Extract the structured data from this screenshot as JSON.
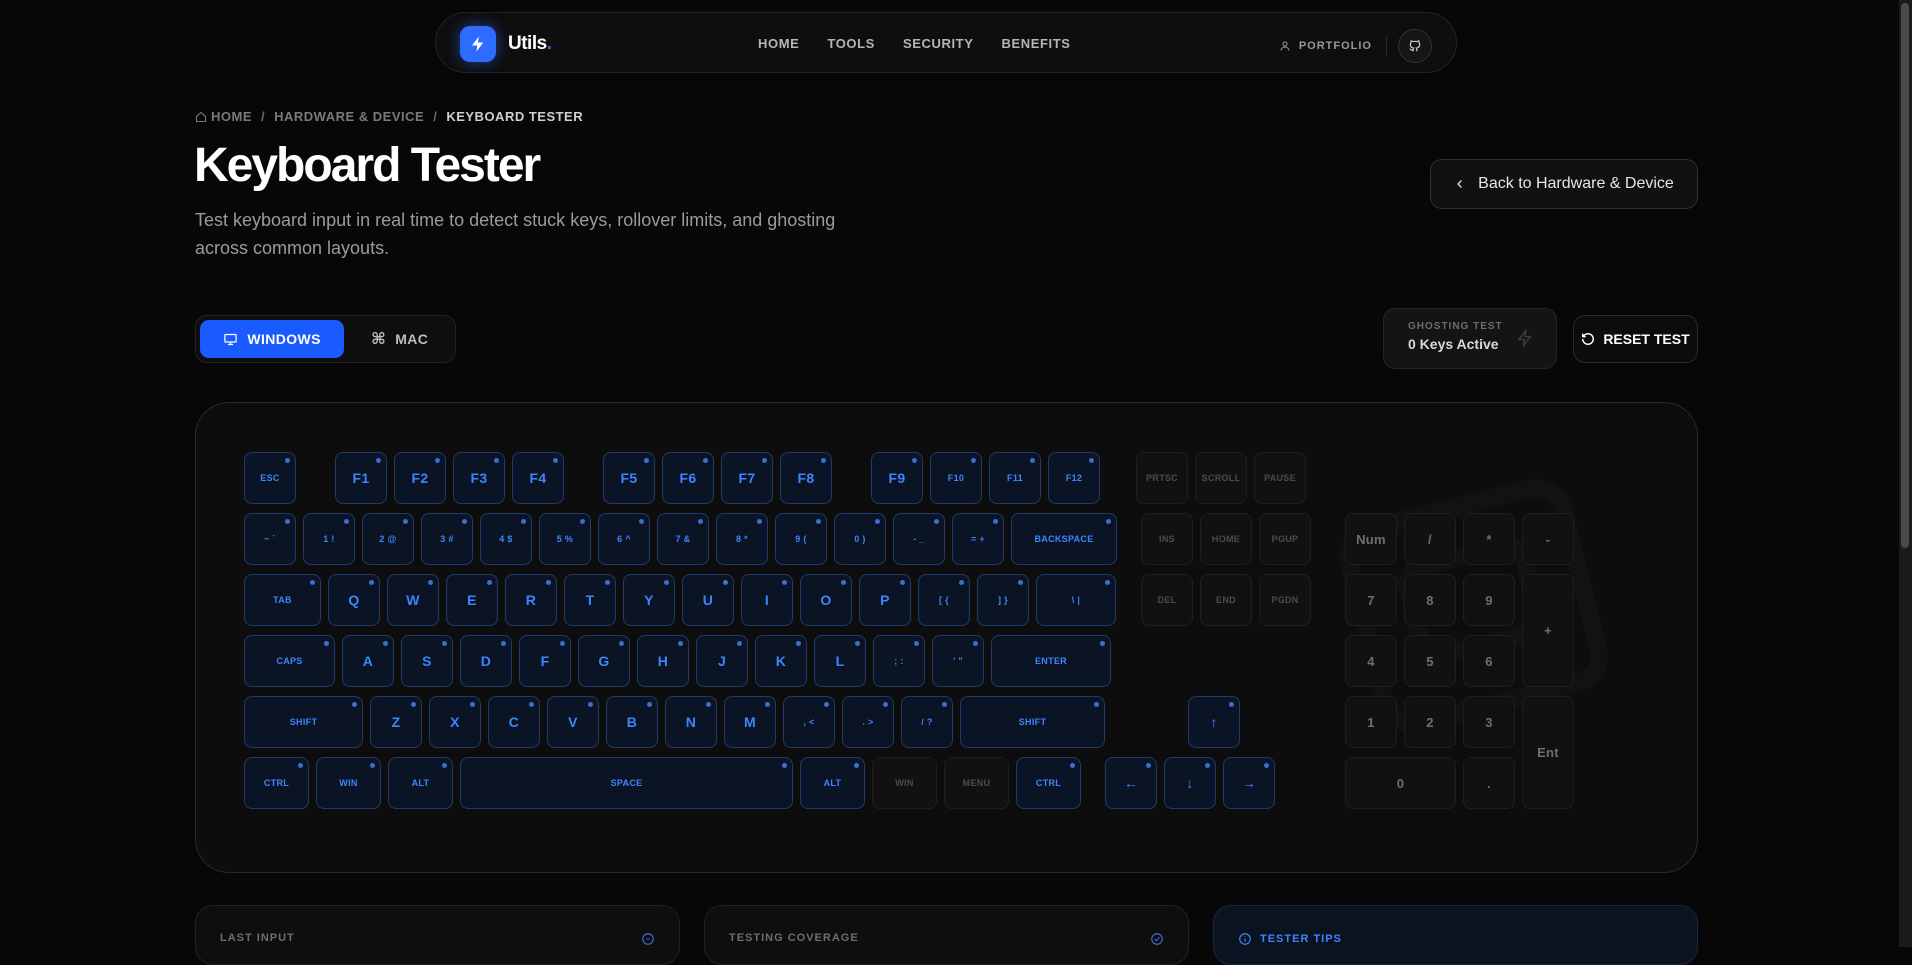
{
  "nav": {
    "logo": "Utils",
    "logo_dot": ".",
    "links": [
      "HOME",
      "TOOLS",
      "SECURITY",
      "BENEFITS"
    ],
    "portfolio": "PORTFOLIO"
  },
  "breadcrumb": {
    "home": "HOME",
    "category": "HARDWARE & DEVICE",
    "current": "KEYBOARD TESTER",
    "separator": "/"
  },
  "page": {
    "title": "Keyboard Tester",
    "description": "Test keyboard input in real time to detect stuck keys, rollover limits, and ghosting across common layouts.",
    "back_label": "Back to Hardware & Device"
  },
  "controls": {
    "os_windows": "WINDOWS",
    "os_mac": "MAC",
    "ghost_label": "GHOSTING TEST",
    "ghost_value": "0 Keys Active",
    "reset_label": "RESET TEST"
  },
  "keyboard": {
    "main_rows": [
      [
        {
          "l": "ESC",
          "w": 52,
          "sm": true
        },
        {
          "gap": 32
        },
        {
          "l": "F1",
          "w": 52,
          "big": true
        },
        {
          "l": "F2",
          "w": 52,
          "big": true
        },
        {
          "l": "F3",
          "w": 52,
          "big": true
        },
        {
          "l": "F4",
          "w": 52,
          "big": true
        },
        {
          "gap": 32
        },
        {
          "l": "F5",
          "w": 52,
          "big": true
        },
        {
          "l": "F6",
          "w": 52,
          "big": true
        },
        {
          "l": "F7",
          "w": 52,
          "big": true
        },
        {
          "l": "F8",
          "w": 52,
          "big": true
        },
        {
          "gap": 32
        },
        {
          "l": "F9",
          "w": 52,
          "big": true
        },
        {
          "l": "F10",
          "w": 52,
          "sm": true
        },
        {
          "l": "F11",
          "w": 52,
          "sm": true
        },
        {
          "l": "F12",
          "w": 52,
          "sm": true
        }
      ],
      [
        {
          "l": "~ `",
          "w": 52,
          "sm": true
        },
        {
          "l": "1 !",
          "w": 52,
          "sm": true
        },
        {
          "l": "2 @",
          "w": 52,
          "sm": true
        },
        {
          "l": "3 #",
          "w": 52,
          "sm": true
        },
        {
          "l": "4 $",
          "w": 52,
          "sm": true
        },
        {
          "l": "5 %",
          "w": 52,
          "sm": true
        },
        {
          "l": "6 ^",
          "w": 52,
          "sm": true
        },
        {
          "l": "7 &",
          "w": 52,
          "sm": true
        },
        {
          "l": "8 *",
          "w": 52,
          "sm": true
        },
        {
          "l": "9 (",
          "w": 52,
          "sm": true
        },
        {
          "l": "0 )",
          "w": 52,
          "sm": true
        },
        {
          "l": "- _",
          "w": 52,
          "sm": true
        },
        {
          "l": "= +",
          "w": 52,
          "sm": true
        },
        {
          "l": "BACKSPACE",
          "w": 106,
          "sm": true
        }
      ],
      [
        {
          "l": "TAB",
          "w": 77,
          "sm": true
        },
        {
          "l": "Q",
          "w": 52,
          "big": true
        },
        {
          "l": "W",
          "w": 52,
          "big": true
        },
        {
          "l": "E",
          "w": 52,
          "big": true
        },
        {
          "l": "R",
          "w": 52,
          "big": true
        },
        {
          "l": "T",
          "w": 52,
          "big": true
        },
        {
          "l": "Y",
          "w": 52,
          "big": true
        },
        {
          "l": "U",
          "w": 52,
          "big": true
        },
        {
          "l": "I",
          "w": 52,
          "big": true
        },
        {
          "l": "O",
          "w": 52,
          "big": true
        },
        {
          "l": "P",
          "w": 52,
          "big": true
        },
        {
          "l": "[ {",
          "w": 52,
          "sm": true
        },
        {
          "l": "] }",
          "w": 52,
          "sm": true
        },
        {
          "l": "\\ |",
          "w": 80,
          "sm": true
        }
      ],
      [
        {
          "l": "CAPS",
          "w": 91,
          "sm": true
        },
        {
          "l": "A",
          "w": 52,
          "big": true
        },
        {
          "l": "S",
          "w": 52,
          "big": true
        },
        {
          "l": "D",
          "w": 52,
          "big": true
        },
        {
          "l": "F",
          "w": 52,
          "big": true
        },
        {
          "l": "G",
          "w": 52,
          "big": true
        },
        {
          "l": "H",
          "w": 52,
          "big": true
        },
        {
          "l": "J",
          "w": 52,
          "big": true
        },
        {
          "l": "K",
          "w": 52,
          "big": true
        },
        {
          "l": "L",
          "w": 52,
          "big": true
        },
        {
          "l": "; :",
          "w": 52,
          "sm": true
        },
        {
          "l": "' \"",
          "w": 52,
          "sm": true
        },
        {
          "l": "ENTER",
          "w": 120,
          "sm": true
        }
      ],
      [
        {
          "l": "SHIFT",
          "w": 119,
          "sm": true
        },
        {
          "l": "Z",
          "w": 52,
          "big": true
        },
        {
          "l": "X",
          "w": 52,
          "big": true
        },
        {
          "l": "C",
          "w": 52,
          "big": true
        },
        {
          "l": "V",
          "w": 52,
          "big": true
        },
        {
          "l": "B",
          "w": 52,
          "big": true
        },
        {
          "l": "N",
          "w": 52,
          "big": true
        },
        {
          "l": "M",
          "w": 52,
          "big": true
        },
        {
          "l": ", <",
          "w": 52,
          "sm": true
        },
        {
          "l": ". >",
          "w": 52,
          "sm": true
        },
        {
          "l": "/ ?",
          "w": 52,
          "sm": true
        },
        {
          "l": "SHIFT",
          "w": 145,
          "sm": true
        }
      ],
      [
        {
          "l": "CTRL",
          "w": 65,
          "sm": true
        },
        {
          "l": "WIN",
          "w": 65,
          "sm": true
        },
        {
          "l": "ALT",
          "w": 65,
          "sm": true
        },
        {
          "l": "SPACE",
          "w": 333,
          "sm": true
        },
        {
          "l": "ALT",
          "w": 65,
          "sm": true
        },
        {
          "l": "WIN",
          "w": 65,
          "sm": true,
          "dis": true
        },
        {
          "l": "MENU",
          "w": 65,
          "sm": true,
          "dis": true
        },
        {
          "l": "CTRL",
          "w": 65,
          "sm": true
        }
      ]
    ],
    "nav_block": [
      [
        "PRTSC",
        "SCROLL",
        "PAUSE"
      ],
      [
        "INS",
        "HOME",
        "PGUP"
      ],
      [
        "DEL",
        "END",
        "PGDN"
      ]
    ],
    "arrows": {
      "up": "↑",
      "left": "←",
      "down": "↓",
      "right": "→"
    },
    "numpad": {
      "rows": [
        [
          "Num",
          "/",
          "*",
          "-"
        ],
        [
          "7",
          "8",
          "9"
        ],
        [
          "4",
          "5",
          "6"
        ],
        [
          "1",
          "2",
          "3"
        ]
      ],
      "plus": "+",
      "enter": "Ent",
      "zero": "0",
      "dot": "."
    }
  },
  "cards": {
    "last_input": "LAST INPUT",
    "coverage": "TESTING COVERAGE",
    "tips": "TESTER TIPS"
  },
  "colors": {
    "accent": "#1a5bff",
    "key_text": "#3b86ff",
    "background": "#070707"
  }
}
